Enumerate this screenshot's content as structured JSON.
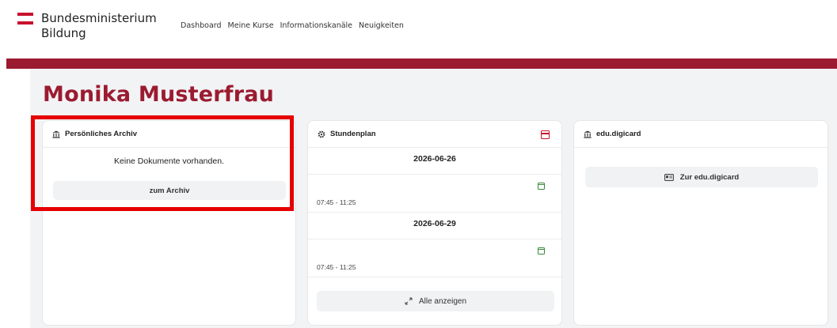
{
  "header": {
    "logo_line1": "Bundesministerium",
    "logo_line2": "Bildung",
    "nav": [
      "Dashboard",
      "Meine Kurse",
      "Informationskanäle",
      "Neuigkeiten"
    ]
  },
  "page": {
    "title": "Monika Musterfrau"
  },
  "archive_card": {
    "title": "Persönliches Archiv",
    "empty_message": "Keine Dokumente vorhanden.",
    "button_label": "zum Archiv"
  },
  "schedule_card": {
    "title": "Stundenplan",
    "days": [
      {
        "date": "2026-06-26",
        "time": "07:45 - 11:25"
      },
      {
        "date": "2026-06-29",
        "time": "07:45 - 11:25"
      }
    ],
    "show_all_label": "Alle anzeigen"
  },
  "digicard_card": {
    "title": "edu.digicard",
    "button_label": "Zur edu.digicard"
  },
  "colors": {
    "brand": "#9b1b30",
    "logo_red": "#c8102e",
    "highlight": "#e60000",
    "calendar_green": "#3a8a3a"
  },
  "icons": {
    "archive": "building-columns-icon",
    "schedule": "gear-icon",
    "calendar": "calendar-icon",
    "expand": "expand-icon",
    "card": "id-card-icon"
  }
}
